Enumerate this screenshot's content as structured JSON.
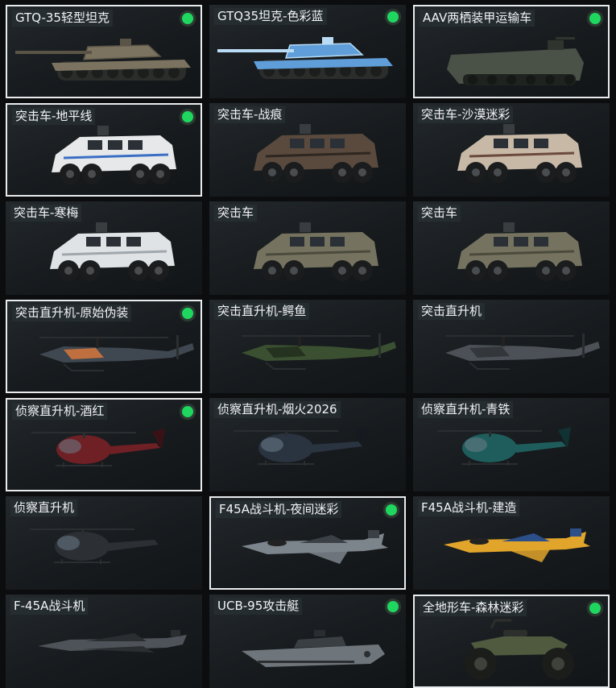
{
  "cards": [
    {
      "label": "GTQ-35轻型坦克",
      "type": "tank",
      "color": "#7b735f",
      "accent": "#5a5446",
      "selected": true,
      "badge": true
    },
    {
      "label": "GTQ35坦克-色彩蓝",
      "type": "tank",
      "color": "#5f9ed8",
      "accent": "#b9dbf5",
      "selected": false,
      "badge": true
    },
    {
      "label": "AAV两栖装甲运输车",
      "type": "amphib",
      "color": "#4a5147",
      "accent": "#2f352e",
      "selected": true,
      "badge": true
    },
    {
      "label": "突击车-地平线",
      "type": "truck",
      "color": "#e6e8ea",
      "accent": "#3a6fc4",
      "selected": true,
      "badge": true
    },
    {
      "label": "突击车-战痕",
      "type": "truck",
      "color": "#5a4a3e",
      "accent": "#2e2620",
      "selected": false,
      "badge": false
    },
    {
      "label": "突击车-沙漠迷彩",
      "type": "truck",
      "color": "#c8b8a6",
      "accent": "#6b4a3c",
      "selected": false,
      "badge": false
    },
    {
      "label": "突击车-寒梅",
      "type": "truck",
      "color": "#dfe3e6",
      "accent": "#a0a7ad",
      "selected": false,
      "badge": false
    },
    {
      "label": "突击车",
      "type": "truck",
      "color": "#75735f",
      "accent": "#4b4a3d",
      "selected": false,
      "badge": false
    },
    {
      "label": "突击车",
      "type": "truck",
      "color": "#75735f",
      "accent": "#4b4a3d",
      "selected": false,
      "badge": false
    },
    {
      "label": "突击直升机-原始伪装",
      "type": "attackheli",
      "color": "#3f4750",
      "accent": "#e07a3a",
      "selected": true,
      "badge": true
    },
    {
      "label": "突击直升机-鳄鱼",
      "type": "attackheli",
      "color": "#3a5030",
      "accent": "#1f2a1b",
      "selected": false,
      "badge": false
    },
    {
      "label": "突击直升机",
      "type": "attackheli",
      "color": "#4b5157",
      "accent": "#2d3135",
      "selected": false,
      "badge": false
    },
    {
      "label": "侦察直升机-酒红",
      "type": "scoutheli",
      "color": "#6e2025",
      "accent": "#3a1215",
      "selected": true,
      "badge": true
    },
    {
      "label": "侦察直升机-烟火2026",
      "type": "scoutheli",
      "color": "#2a3340",
      "accent": "#151a20",
      "selected": false,
      "badge": false
    },
    {
      "label": "侦察直升机-青铁",
      "type": "scoutheli",
      "color": "#1f5d5c",
      "accent": "#103232",
      "selected": false,
      "badge": false
    },
    {
      "label": "侦察直升机",
      "type": "scoutheli",
      "color": "#2c3035",
      "accent": "#181b1e",
      "selected": false,
      "badge": false
    },
    {
      "label": "F45A战斗机-夜间迷彩",
      "type": "jet",
      "color": "#7d858c",
      "accent": "#3a4046",
      "selected": true,
      "badge": true
    },
    {
      "label": "F45A战斗机-建造",
      "type": "jet",
      "color": "#e0a52a",
      "accent": "#2c4f8a",
      "selected": false,
      "badge": false
    },
    {
      "label": "F-45A战斗机",
      "type": "stealthjet",
      "color": "#4d5358",
      "accent": "#2a2e31",
      "selected": false,
      "badge": false
    },
    {
      "label": "UCB-95攻击艇",
      "type": "boat",
      "color": "#6e767c",
      "accent": "#3a3f43",
      "selected": false,
      "badge": true
    },
    {
      "label": "全地形车-森林迷彩",
      "type": "atv",
      "color": "#4f5a3e",
      "accent": "#2a2f22",
      "selected": true,
      "badge": true
    }
  ]
}
